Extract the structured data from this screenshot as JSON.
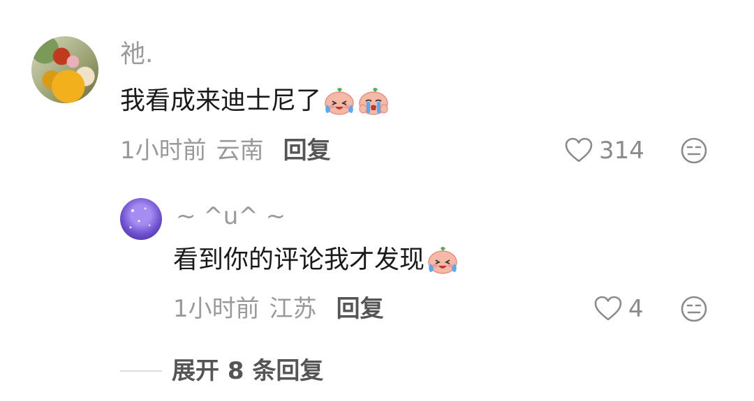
{
  "comment": {
    "username": "祂.",
    "text": "我看成来迪士尼了",
    "emojis": [
      "laugh-cry-peach-emoji",
      "cry-peach-emoji"
    ],
    "time": "1小时前",
    "location": "云南",
    "reply_label": "回复",
    "like_count": "314"
  },
  "reply": {
    "username": "~ ^u^ ~",
    "text": "看到你的评论我才发现",
    "emojis": [
      "laugh-cry-peach-emoji"
    ],
    "time": "1小时前",
    "location": "江苏",
    "reply_label": "回复",
    "like_count": "4"
  },
  "expand": {
    "label": "展开 8 条回复"
  },
  "colors": {
    "text_primary": "#1a1a1a",
    "text_secondary": "#9a9a9a",
    "reply_action": "#555555",
    "emoji_peach": "#f6b9a8"
  }
}
